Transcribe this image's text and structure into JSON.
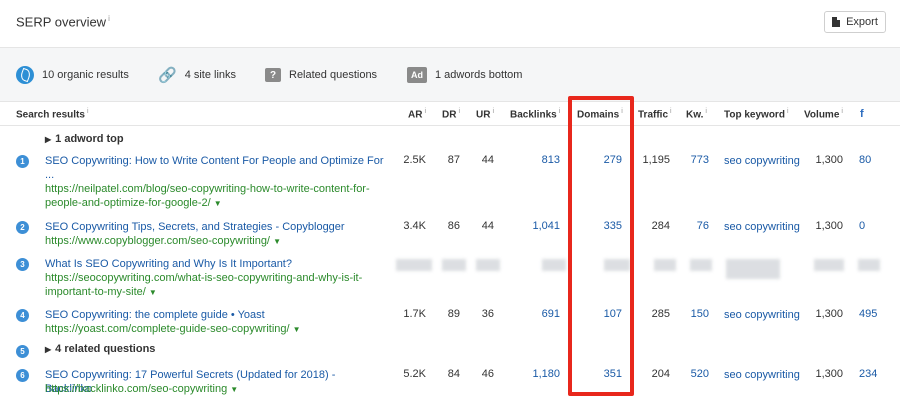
{
  "header": {
    "title": "SERP overview",
    "info": "i",
    "export_label": "Export"
  },
  "summary": {
    "organic": "10 organic results",
    "sitelinks": "4 site links",
    "related": "Related questions",
    "adwords": "1 adwords bottom"
  },
  "columns": {
    "search_results": "Search results",
    "ar": "AR",
    "dr": "DR",
    "ur": "UR",
    "backlinks": "Backlinks",
    "domains": "Domains",
    "traffic": "Traffic",
    "kw": "Kw.",
    "top_keyword": "Top keyword",
    "volume": "Volume",
    "fb": "f",
    "info": "i"
  },
  "adword_top": "1 adword top",
  "related_questions": "4 related questions",
  "rows": [
    {
      "num": "1",
      "title": "SEO Copywriting: How to Write Content For People and Optimize For ...",
      "url": "https://neilpatel.com/blog/seo-copywriting-how-to-write-content-for-people-and-optimize-for-google-2/",
      "ar": "2.5K",
      "dr": "87",
      "ur": "44",
      "backlinks": "813",
      "domains": "279",
      "traffic": "1,195",
      "kw": "773",
      "top_keyword": "seo copywriting",
      "volume": "1,300",
      "fb": "80"
    },
    {
      "num": "2",
      "title": "SEO Copywriting Tips, Secrets, and Strategies - Copyblogger",
      "url": "https://www.copyblogger.com/seo-copywriting/",
      "ar": "3.4K",
      "dr": "86",
      "ur": "44",
      "backlinks": "1,041",
      "domains": "335",
      "traffic": "284",
      "kw": "76",
      "top_keyword": "seo copywriting",
      "volume": "1,300",
      "fb": "0"
    },
    {
      "num": "3",
      "title": "What Is SEO Copywriting and Why Is It Important?",
      "url": "https://seocopywriting.com/what-is-seo-copywriting-and-why-is-it-important-to-my-site/"
    },
    {
      "num": "4",
      "title": "SEO Copywriting: the complete guide • Yoast",
      "url": "https://yoast.com/complete-guide-seo-copywriting/",
      "ar": "1.7K",
      "dr": "89",
      "ur": "36",
      "backlinks": "691",
      "domains": "107",
      "traffic": "285",
      "kw": "150",
      "top_keyword": "seo copywriting",
      "volume": "1,300",
      "fb": "495"
    },
    {
      "num": "5"
    },
    {
      "num": "6",
      "title": "SEO Copywriting: 17 Powerful Secrets (Updated for 2018) - Backlinko",
      "url": "https://backlinko.com/seo-copywriting",
      "ar": "5.2K",
      "dr": "84",
      "ur": "46",
      "backlinks": "1,180",
      "domains": "351",
      "traffic": "204",
      "kw": "520",
      "top_keyword": "seo copywriting",
      "volume": "1,300",
      "fb": "234"
    }
  ],
  "colors": {
    "accent": "#2d8fd5",
    "link": "#1a5aa6",
    "url": "#2b8a2b",
    "highlight": "#e8271c"
  }
}
